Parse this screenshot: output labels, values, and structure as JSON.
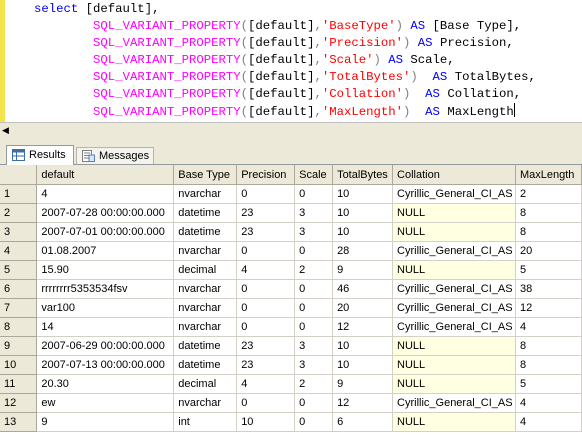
{
  "editor": {
    "lines": [
      [
        {
          "t": "select ",
          "c": "kw"
        },
        {
          "t": "[default],",
          "c": "plain"
        }
      ],
      [
        {
          "t": "        ",
          "c": "plain"
        },
        {
          "t": "SQL_VARIANT_PROPERTY",
          "c": "fn"
        },
        {
          "t": "(",
          "c": "op"
        },
        {
          "t": "[default]",
          "c": "plain"
        },
        {
          "t": ",",
          "c": "op"
        },
        {
          "t": "'BaseType'",
          "c": "str"
        },
        {
          "t": ") ",
          "c": "op"
        },
        {
          "t": "AS ",
          "c": "kw"
        },
        {
          "t": "[Base Type],",
          "c": "plain"
        }
      ],
      [
        {
          "t": "        ",
          "c": "plain"
        },
        {
          "t": "SQL_VARIANT_PROPERTY",
          "c": "fn"
        },
        {
          "t": "(",
          "c": "op"
        },
        {
          "t": "[default]",
          "c": "plain"
        },
        {
          "t": ",",
          "c": "op"
        },
        {
          "t": "'Precision'",
          "c": "str"
        },
        {
          "t": ") ",
          "c": "op"
        },
        {
          "t": "AS ",
          "c": "kw"
        },
        {
          "t": "Precision,",
          "c": "plain"
        }
      ],
      [
        {
          "t": "        ",
          "c": "plain"
        },
        {
          "t": "SQL_VARIANT_PROPERTY",
          "c": "fn"
        },
        {
          "t": "(",
          "c": "op"
        },
        {
          "t": "[default]",
          "c": "plain"
        },
        {
          "t": ",",
          "c": "op"
        },
        {
          "t": "'Scale'",
          "c": "str"
        },
        {
          "t": ") ",
          "c": "op"
        },
        {
          "t": "AS ",
          "c": "kw"
        },
        {
          "t": "Scale,",
          "c": "plain"
        }
      ],
      [
        {
          "t": "        ",
          "c": "plain"
        },
        {
          "t": "SQL_VARIANT_PROPERTY",
          "c": "fn"
        },
        {
          "t": "(",
          "c": "op"
        },
        {
          "t": "[default]",
          "c": "plain"
        },
        {
          "t": ",",
          "c": "op"
        },
        {
          "t": "'TotalBytes'",
          "c": "str"
        },
        {
          "t": ")  ",
          "c": "op"
        },
        {
          "t": "AS ",
          "c": "kw"
        },
        {
          "t": "TotalBytes,",
          "c": "plain"
        }
      ],
      [
        {
          "t": "        ",
          "c": "plain"
        },
        {
          "t": "SQL_VARIANT_PROPERTY",
          "c": "fn"
        },
        {
          "t": "(",
          "c": "op"
        },
        {
          "t": "[default]",
          "c": "plain"
        },
        {
          "t": ",",
          "c": "op"
        },
        {
          "t": "'Collation'",
          "c": "str"
        },
        {
          "t": ")  ",
          "c": "op"
        },
        {
          "t": "AS ",
          "c": "kw"
        },
        {
          "t": "Collation,",
          "c": "plain"
        }
      ],
      [
        {
          "t": "        ",
          "c": "plain"
        },
        {
          "t": "SQL_VARIANT_PROPERTY",
          "c": "fn"
        },
        {
          "t": "(",
          "c": "op"
        },
        {
          "t": "[default]",
          "c": "plain"
        },
        {
          "t": ",",
          "c": "op"
        },
        {
          "t": "'MaxLength'",
          "c": "str"
        },
        {
          "t": ")  ",
          "c": "op"
        },
        {
          "t": "AS ",
          "c": "kw"
        },
        {
          "t": "MaxLength",
          "c": "plain"
        }
      ]
    ]
  },
  "tabs": [
    {
      "label": "Results",
      "icon": "grid-icon",
      "active": true
    },
    {
      "label": "Messages",
      "icon": "messages-icon",
      "active": false
    }
  ],
  "grid": {
    "columns": [
      "",
      "default",
      "Base Type",
      "Precision",
      "Scale",
      "TotalBytes",
      "Collation",
      "MaxLength"
    ],
    "rows": [
      [
        "1",
        "4",
        "nvarchar",
        "0",
        "0",
        "10",
        "Cyrillic_General_CI_AS",
        "2"
      ],
      [
        "2",
        "2007-07-28 00:00:00.000",
        "datetime",
        "23",
        "3",
        "10",
        "NULL",
        "8"
      ],
      [
        "3",
        "2007-07-01 00:00:00.000",
        "datetime",
        "23",
        "3",
        "10",
        "NULL",
        "8"
      ],
      [
        "4",
        "01.08.2007",
        "nvarchar",
        "0",
        "0",
        "28",
        "Cyrillic_General_CI_AS",
        "20"
      ],
      [
        "5",
        "15.90",
        "decimal",
        "4",
        "2",
        "9",
        "NULL",
        "5"
      ],
      [
        "6",
        "rrrrrrrr5353534fsv",
        "nvarchar",
        "0",
        "0",
        "46",
        "Cyrillic_General_CI_AS",
        "38"
      ],
      [
        "7",
        "var100",
        "nvarchar",
        "0",
        "0",
        "20",
        "Cyrillic_General_CI_AS",
        "12"
      ],
      [
        "8",
        "14",
        "nvarchar",
        "0",
        "0",
        "12",
        "Cyrillic_General_CI_AS",
        "4"
      ],
      [
        "9",
        "2007-06-29 00:00:00.000",
        "datetime",
        "23",
        "3",
        "10",
        "NULL",
        "8"
      ],
      [
        "10",
        "2007-07-13 00:00:00.000",
        "datetime",
        "23",
        "3",
        "10",
        "NULL",
        "8"
      ],
      [
        "11",
        "20.30",
        "decimal",
        "4",
        "2",
        "9",
        "NULL",
        "5"
      ],
      [
        "12",
        "ew",
        "nvarchar",
        "0",
        "0",
        "12",
        "Cyrillic_General_CI_AS",
        "4"
      ],
      [
        "13",
        "9",
        "int",
        "10",
        "0",
        "6",
        "NULL",
        "4"
      ]
    ]
  },
  "colors": {
    "keyword": "#0000ff",
    "function": "#ff00ff",
    "string": "#ff0000",
    "null_cell_bg": "#ffffe1",
    "chrome": "#ece9d8"
  }
}
